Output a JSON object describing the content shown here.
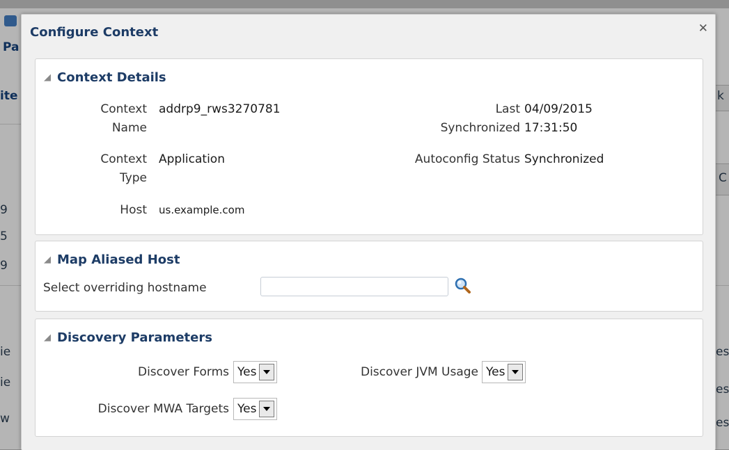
{
  "background": {
    "fragments": [
      "Pa",
      "ite",
      "9",
      "5",
      "9",
      "ie",
      "ie",
      "w",
      "k",
      "C",
      "es",
      "es",
      "es"
    ]
  },
  "dialog": {
    "title": "Configure Context",
    "close_icon": "close-icon",
    "context_details": {
      "header": "Context Details",
      "context_name_label_1": "Context",
      "context_name_label_2": "Name",
      "context_name_value": "addrp9_rws3270781",
      "context_type_label_1": "Context",
      "context_type_label_2": "Type",
      "context_type_value": "Application",
      "host_label": "Host",
      "host_value": "us.example.com",
      "last_sync_label_1": "Last",
      "last_sync_label_2": "Synchronized",
      "last_sync_date": "04/09/2015",
      "last_sync_time": "17:31:50",
      "autoconfig_label": "Autoconfig Status",
      "autoconfig_value": "Synchronized"
    },
    "map_aliased_host": {
      "header": "Map Aliased Host",
      "hostname_label": "Select overriding hostname",
      "hostname_value": "",
      "search_icon": "search-icon"
    },
    "discovery_parameters": {
      "header": "Discovery Parameters",
      "forms_label": "Discover Forms",
      "forms_value": "Yes",
      "jvm_label": "Discover JVM Usage",
      "jvm_value": "Yes",
      "mwa_label": "Discover MWA Targets",
      "mwa_value": "Yes"
    }
  }
}
